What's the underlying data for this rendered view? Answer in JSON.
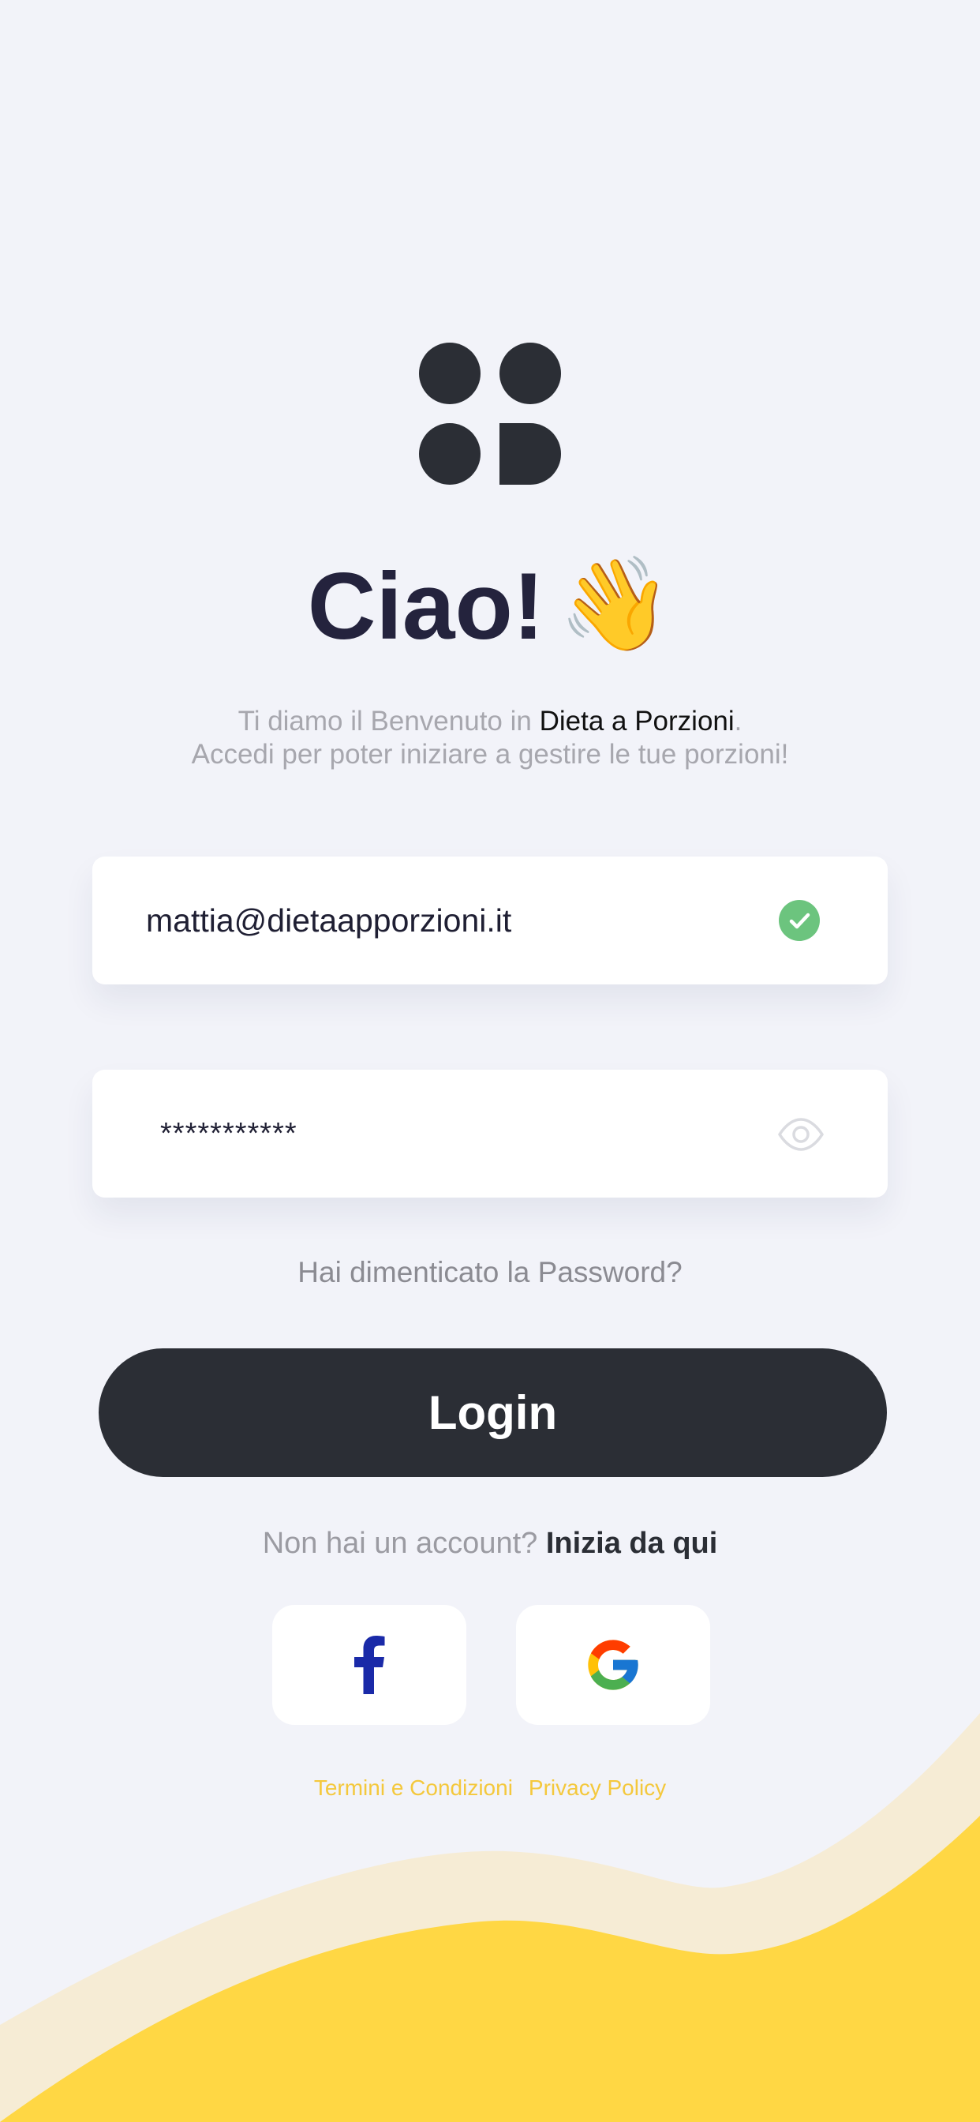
{
  "colors": {
    "background": "#f2f3f9",
    "dark": "#2b2e35",
    "title": "#24233d",
    "accent_yellow": "#ffd744",
    "wave_light": "#f6ecd5",
    "success_green": "#6cc47e"
  },
  "greeting": {
    "title": "Ciao!",
    "emoji": "👋"
  },
  "welcome": {
    "prefix": "Ti diamo il Benvenuto in ",
    "brand": "Dieta a Porzioni",
    "suffix": ".",
    "line2": "Accedi per poter iniziare a gestire le tue porzioni!"
  },
  "email_field": {
    "value": "mattia@dietaapporzioni.it",
    "status_icon": "check-circle-icon"
  },
  "password_field": {
    "value": "***********",
    "toggle_icon": "eye-icon"
  },
  "forgot_password": "Hai dimenticato la Password?",
  "login_button": "Login",
  "signup": {
    "prompt": "Non hai un account? ",
    "link": "Inizia da qui"
  },
  "social": [
    {
      "provider": "facebook",
      "icon": "facebook-icon"
    },
    {
      "provider": "google",
      "icon": "google-icon"
    }
  ],
  "legal": {
    "terms": "Termini e Condizioni",
    "privacy": "Privacy Policy"
  }
}
